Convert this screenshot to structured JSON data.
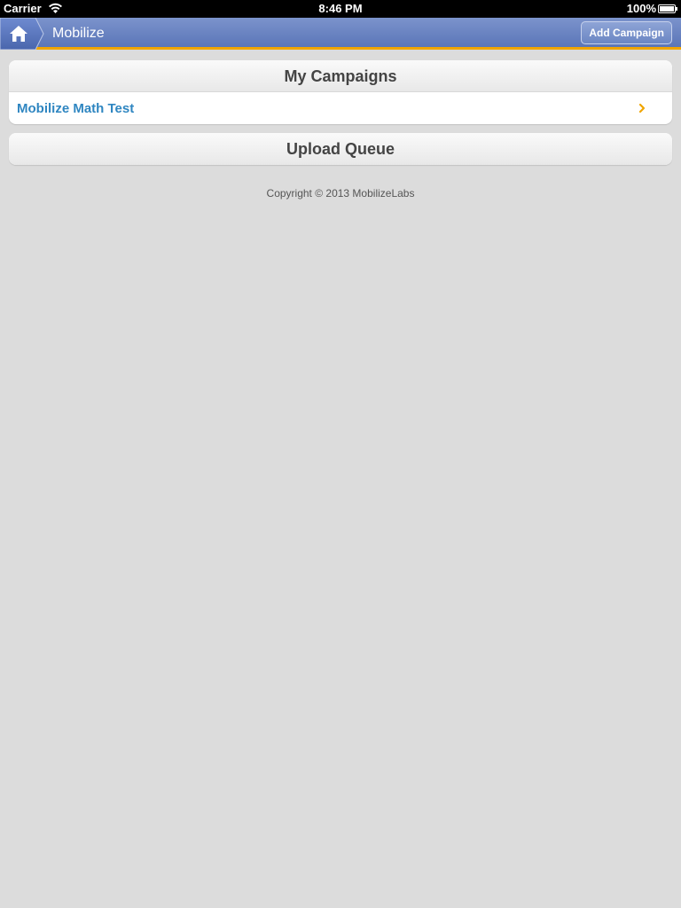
{
  "status_bar": {
    "carrier": "Carrier",
    "time": "8:46 PM",
    "battery": "100%",
    "wifi_icon": "wifi-icon",
    "battery_icon": "battery-icon"
  },
  "nav": {
    "home_icon": "home-icon",
    "title": "Mobilize",
    "add_campaign_label": "Add Campaign",
    "accent_color": "#f0a500",
    "bar_color": "#6a84c2"
  },
  "campaigns": {
    "header": "My Campaigns",
    "items": [
      {
        "label": "Mobilize Math Test",
        "icon": "chevron-right-icon"
      }
    ]
  },
  "upload_queue": {
    "header": "Upload Queue"
  },
  "footer": {
    "copyright": "Copyright © 2013 MobilizeLabs"
  }
}
